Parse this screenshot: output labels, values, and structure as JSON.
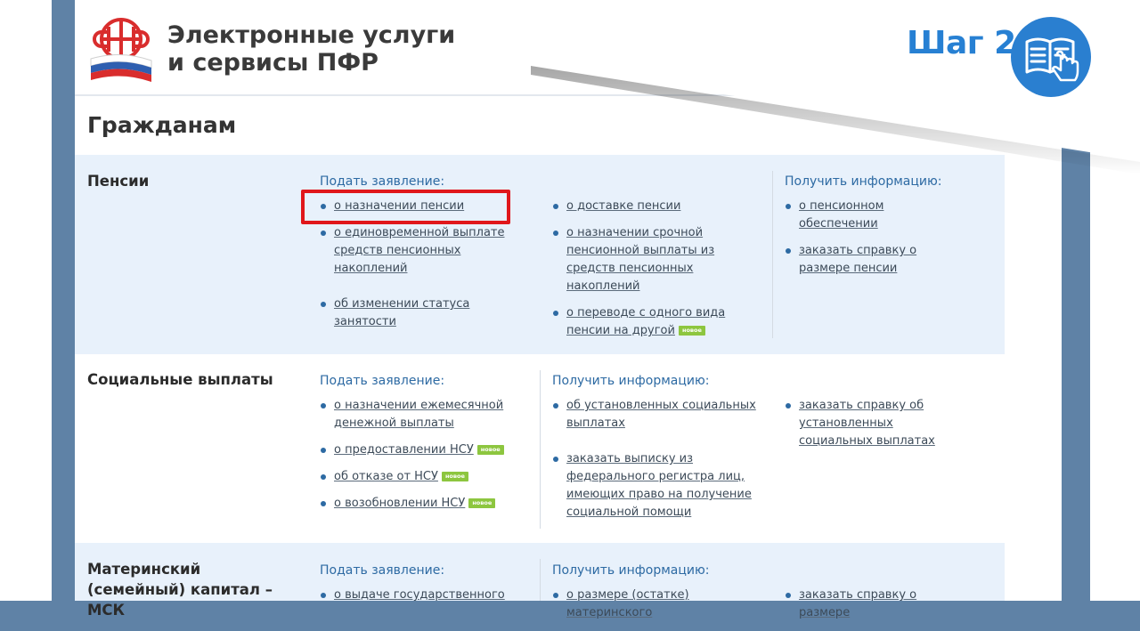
{
  "header": {
    "title_line1": "Электронные услуги",
    "title_line2": "и сервисы ПФР"
  },
  "step": {
    "label": "Шаг 2"
  },
  "page_title": "Гражданам",
  "badge_text": "новое",
  "sections": {
    "pensions": {
      "title": "Пенсии",
      "col1_head": "Подать заявление:",
      "col1": [
        "о назначении пенсии",
        "о единовременной выплате средств пенсионных накоплений",
        "об изменении статуса занятости"
      ],
      "col2": [
        "о доставке пенсии",
        "о назначении срочной пенсионной выплаты из средств пенсионных накоплений",
        "о переводе с одного вида пенсии на другой"
      ],
      "col3_head": "Получить информацию:",
      "col3": [
        "о пенсионном обеспечении",
        "заказать справку о размере пенсии"
      ]
    },
    "social": {
      "title": "Социальные выплаты",
      "col1_head": "Подать заявление:",
      "col1": [
        "о назначении ежемесячной денежной выплаты",
        "о предоставлении НСУ",
        "об отказе от НСУ",
        "о возобновлении НСУ"
      ],
      "col2_head": "Получить информацию:",
      "col2": [
        "об установленных социальных выплатах",
        "заказать выписку из федерального регистра лиц, имеющих право на получение социальной помощи"
      ],
      "col3": [
        "заказать справку об установленных социальных выплатах"
      ]
    },
    "maternity": {
      "title": "Материнский (семейный) капитал – МСК",
      "col1_head": "Подать заявление:",
      "col1": [
        "о выдаче государственного"
      ],
      "col2_head": "Получить информацию:",
      "col2": [
        "о размере (остатке) материнского"
      ],
      "col3": [
        "заказать справку о размере"
      ]
    }
  },
  "colors": {
    "accent": "#2780d3",
    "link_head": "#2d6aa3",
    "section_bg": "#e8f1fb",
    "badge": "#8dc63f",
    "highlight": "#e0171b"
  }
}
